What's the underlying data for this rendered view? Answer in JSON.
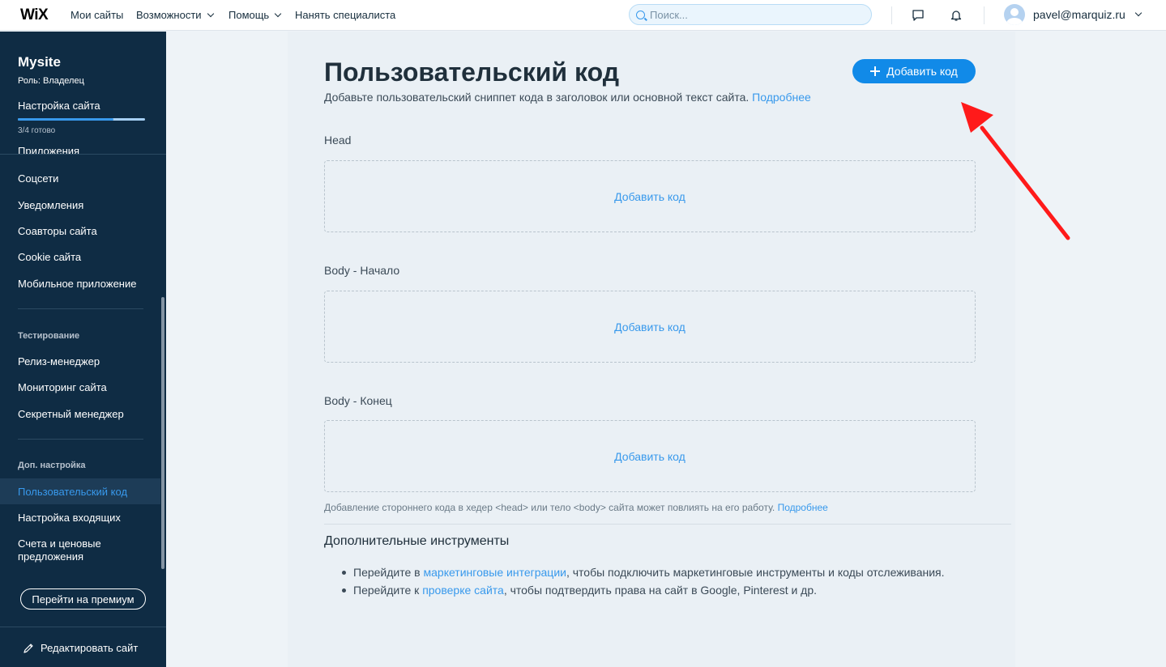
{
  "topbar": {
    "logo": "WiX",
    "nav": [
      "Мои сайты",
      "Возможности",
      "Помощь",
      "Нанять специалиста"
    ],
    "search_placeholder": "Поиск...",
    "user_email": "pavel@marquiz.ru"
  },
  "sidebar": {
    "site_name": "Mysite",
    "role": "Роль: Владелец",
    "setup_label": "Настройка сайта",
    "progress_text": "3/4 готово",
    "progress_fraction": 0.75,
    "cut_item": "Приложения",
    "items_group1": [
      "Соцсети",
      "Уведомления",
      "Соавторы сайта",
      "Cookie сайта",
      "Мобильное приложение"
    ],
    "section_testing": "Тестирование",
    "items_group2": [
      "Релиз-менеджер",
      "Мониторинг сайта",
      "Секретный менеджер"
    ],
    "section_advanced": "Доп. настройка",
    "items_group3": [
      "Пользовательский код",
      "Настройка входящих",
      "Счета и ценовые предложения"
    ],
    "premium_button": "Перейти на премиум",
    "edit_site": "Редактировать сайт"
  },
  "main": {
    "title": "Пользовательский код",
    "subtitle": "Добавьте пользовательский сниппет кода в заголовок или основной текст сайта.",
    "subtitle_link": "Подробнее",
    "add_button": "Добавить код",
    "sections": [
      {
        "label": "Head",
        "action": "Добавить код"
      },
      {
        "label": "Body - Начало",
        "action": "Добавить код"
      },
      {
        "label": "Body - Конец",
        "action": "Добавить код"
      }
    ],
    "note": "Добавление стороннего кода в хедер <head> или тело <body> сайта может повлиять на его работу.",
    "note_link": "Подробнее",
    "tools_title": "Дополнительные инструменты",
    "tools": [
      {
        "before": "Перейдите в ",
        "link": "маркетинговые интеграции",
        "after": ", чтобы подключить маркетинговые инструменты и коды отслеживания."
      },
      {
        "before": "Перейдите к ",
        "link": "проверке сайта",
        "after": ", чтобы подтвердить права на сайт в Google, Pinterest и др."
      }
    ]
  },
  "colors": {
    "accent": "#3899ec",
    "button": "#118ae8",
    "sidebar": "#0f2c44",
    "annotation_arrow": "#ff0000"
  }
}
